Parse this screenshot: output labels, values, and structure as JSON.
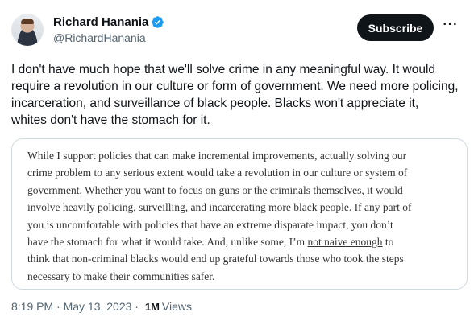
{
  "author": {
    "display_name": "Richard Hanania",
    "handle": "@RichardHanania",
    "verified": true
  },
  "actions": {
    "subscribe_label": "Subscribe",
    "more_label": "···"
  },
  "tweet": {
    "text": "I don't have much hope that we'll solve crime in any meaningful way. It would\nrequire a revolution in our culture or form of government. We need more policing,\nincarceration, and surveillance of black people. Blacks won't appreciate it,\nwhites don't have the stomach for it."
  },
  "quoted_excerpt": {
    "lines": [
      "While I support policies that can make incremental improvements, actually solving our",
      "crime problem to any serious extent would take a revolution in our culture or system of",
      "government. Whether you want to focus on guns or the criminals themselves, it would",
      "involve heavily policing, surveilling, and incarcerating more black people. If any part of",
      "you is uncomfortable with policies that have an extreme disparate impact, you don’t",
      "have the stomach for what it would take. And, unlike some, I’m ",
      "think that non-criminal blacks would end up grateful towards those who took the steps",
      "necessary to make their communities safer."
    ],
    "underlined": "not naive enough",
    "line6_tail": " to"
  },
  "meta": {
    "timestamp": "8:19 PM · May 13, 2023 · ",
    "views_count": "1M",
    "views_label": "Views"
  },
  "colors": {
    "verified_badge": "#1d9bf0",
    "button_bg": "#0f1419",
    "secondary_text": "#536471",
    "border": "#cfd9de"
  }
}
